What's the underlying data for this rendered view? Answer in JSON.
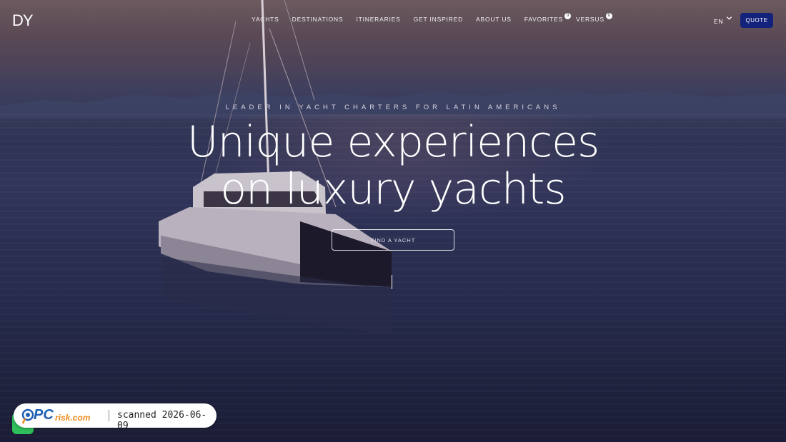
{
  "header": {
    "logo": "DY",
    "nav": [
      {
        "label": "YACHTS"
      },
      {
        "label": "DESTINATIONS"
      },
      {
        "label": "ITINERARIES"
      },
      {
        "label": "GET INSPIRED"
      },
      {
        "label": "ABOUT US"
      },
      {
        "label": "FAVORITES",
        "badge": "0"
      },
      {
        "label": "VERSUS",
        "badge": "0"
      }
    ],
    "language": "EN",
    "quote_label": "QUOTE"
  },
  "hero": {
    "tagline": "LEADER IN YACHT CHARTERS FOR LATIN AMERICANS",
    "headline_line1": "Unique experiences",
    "headline_line2": "on luxury yachts",
    "cta_label": "FIND A YACHT"
  },
  "overlay": {
    "brand": "PCrisk.com",
    "brand_pc": "PC",
    "brand_rest": "risk.com",
    "scan_text": "scanned 2026-06-09"
  },
  "colors": {
    "quote_bg": "#13227a",
    "whatsapp": "#2fbf5b",
    "pcrisk_blue": "#1d5fb4",
    "pcrisk_orange": "#f08a1c"
  },
  "icons": [
    "chevron-down-icon",
    "whatsapp-icon",
    "pcrisk-logo-icon"
  ]
}
